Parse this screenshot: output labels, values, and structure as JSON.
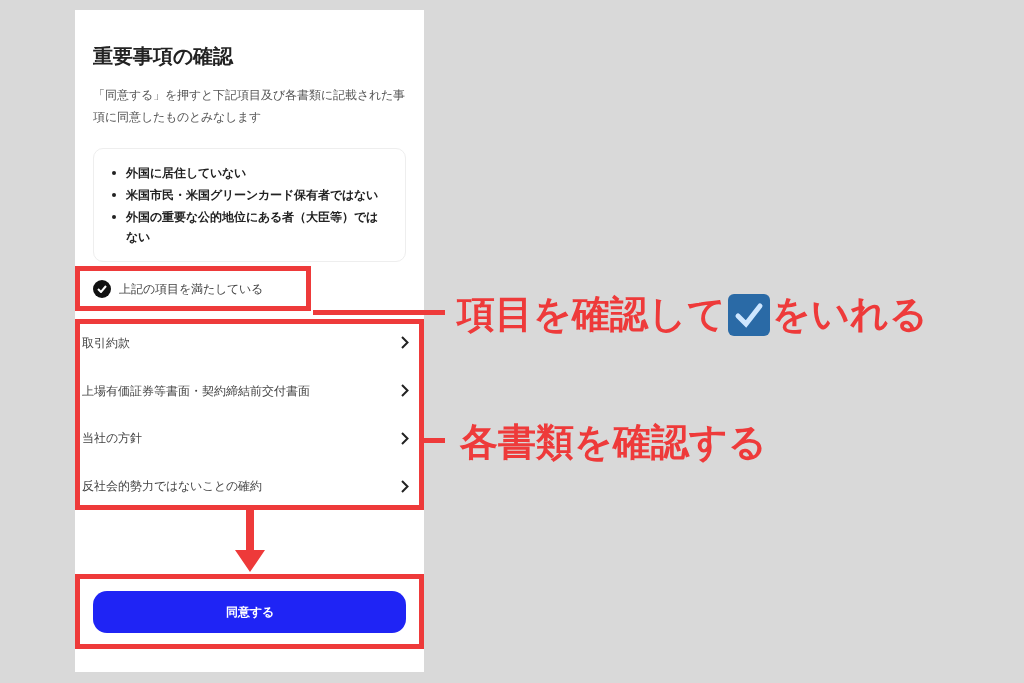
{
  "screen": {
    "title": "重要事項の確認",
    "description": "「同意する」を押すと下記項目及び各書類に記載された事項に同意したものとみなします",
    "conditions": [
      "外国に居住していない",
      "米国市民・米国グリーンカード保有者ではない",
      "外国の重要な公的地位にある者（大臣等）ではない"
    ],
    "confirm_checkbox": {
      "label": "上記の項目を満たしている",
      "checked": true
    },
    "documents": [
      "取引約款",
      "上場有価証券等書面・契約締結前交付書面",
      "当社の方針",
      "反社会的勢力ではないことの確約"
    ],
    "agree_button": "同意する"
  },
  "annotations": [
    {
      "text_before": "項目を確認して",
      "text_after": "をいれる"
    },
    {
      "text_before": "各書類を確認する"
    }
  ]
}
